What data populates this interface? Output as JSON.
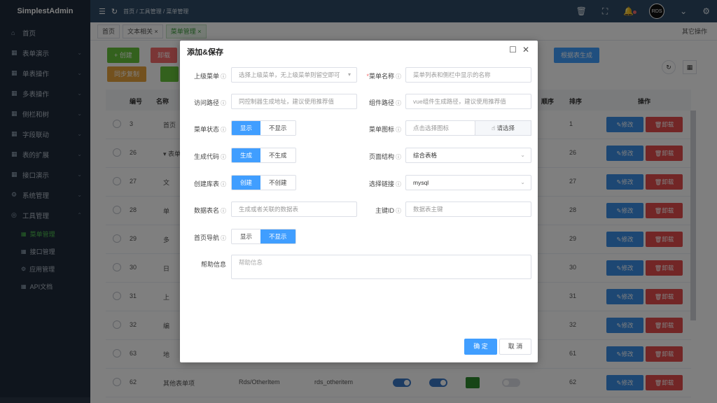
{
  "app": {
    "title": "SimplestAdmin"
  },
  "sidebar": {
    "items": [
      {
        "label": "首页",
        "icon": "home-icon"
      },
      {
        "label": "表单演示",
        "icon": "grid-icon"
      },
      {
        "label": "单表操作",
        "icon": "grid-icon"
      },
      {
        "label": "多表操作",
        "icon": "grid-icon"
      },
      {
        "label": "侧栏和树",
        "icon": "grid-icon"
      },
      {
        "label": "字段联动",
        "icon": "grid-icon"
      },
      {
        "label": "表的扩展",
        "icon": "grid-icon"
      },
      {
        "label": "接口演示",
        "icon": "grid-icon"
      },
      {
        "label": "系统管理",
        "icon": "gear-icon"
      },
      {
        "label": "工具管理",
        "icon": "globe-icon"
      }
    ],
    "subitems": [
      {
        "label": "菜单管理",
        "active": true
      },
      {
        "label": "接口管理",
        "active": false
      },
      {
        "label": "应用管理",
        "active": false
      },
      {
        "label": "API文档",
        "active": false
      }
    ]
  },
  "header": {
    "breadcrumb": "首页 / 工具管理 / 菜单管理",
    "avatar": "RDS"
  },
  "tabs": {
    "items": [
      "首页",
      "文本相关 ×",
      "菜单管理 ×"
    ],
    "other": "其它操作"
  },
  "toolbar": {
    "create": "+ 创建",
    "delete": "卸载",
    "sync": "同步复制",
    "gen": "根据表生成"
  },
  "table": {
    "headers": {
      "id": "编号",
      "name": "名称",
      "order_label": "顺序",
      "sort": "排序",
      "ops": "操作"
    },
    "rows": [
      {
        "id": "3",
        "name": "首页",
        "sort": "1"
      },
      {
        "id": "26",
        "name": "▾ 表单",
        "sort": "26"
      },
      {
        "id": "27",
        "name": "文",
        "sort": "27"
      },
      {
        "id": "28",
        "name": "单",
        "sort": "28"
      },
      {
        "id": "29",
        "name": "多",
        "sort": "29"
      },
      {
        "id": "30",
        "name": "日",
        "sort": "30"
      },
      {
        "id": "31",
        "name": "上",
        "sort": "31"
      },
      {
        "id": "32",
        "name": "编",
        "sort": "32"
      },
      {
        "id": "63",
        "name": "地",
        "sort": "61"
      },
      {
        "id": "62",
        "name": "其他表单项",
        "path": "Rds/OtherItem",
        "table": "rds_otheritem",
        "sort": "62"
      }
    ],
    "edit": "修改",
    "del": "卸载"
  },
  "modal": {
    "title": "添加&保存",
    "parent_menu": {
      "label": "上级菜单",
      "placeholder": "选择上级菜单，无上级菜单则留空即可"
    },
    "menu_name": {
      "label": "菜单名称",
      "placeholder": "菜单列表和侧栏中显示的名称"
    },
    "access_path": {
      "label": "访问路径",
      "placeholder": "同控制器生成地址，建议使用推荐值"
    },
    "component_path": {
      "label": "组件路径",
      "placeholder": "vue组件生成路径，建议使用推荐值"
    },
    "menu_status": {
      "label": "菜单状态",
      "options": [
        "显示",
        "不显示"
      ],
      "selected": "显示"
    },
    "menu_icon": {
      "label": "菜单图标",
      "placeholder": "点击选择图标",
      "button": "请选择"
    },
    "gen_code": {
      "label": "生成代码",
      "options": [
        "生成",
        "不生成"
      ],
      "selected": "生成"
    },
    "page_struct": {
      "label": "页面结构",
      "value": "综合表格"
    },
    "create_table": {
      "label": "创建库表",
      "options": [
        "创建",
        "不创建"
      ],
      "selected": "创建"
    },
    "select_link": {
      "label": "选择链接",
      "value": "mysql"
    },
    "table_name": {
      "label": "数据表名",
      "placeholder": "生成或者关联的数据表"
    },
    "primary_key": {
      "label": "主键ID",
      "placeholder": "数据表主键"
    },
    "home_nav": {
      "label": "首页导航",
      "options": [
        "显示",
        "不显示"
      ],
      "selected": "不显示"
    },
    "help": {
      "label": "帮助信息",
      "placeholder": "帮助信息"
    },
    "ok": "确 定",
    "cancel": "取 消"
  }
}
